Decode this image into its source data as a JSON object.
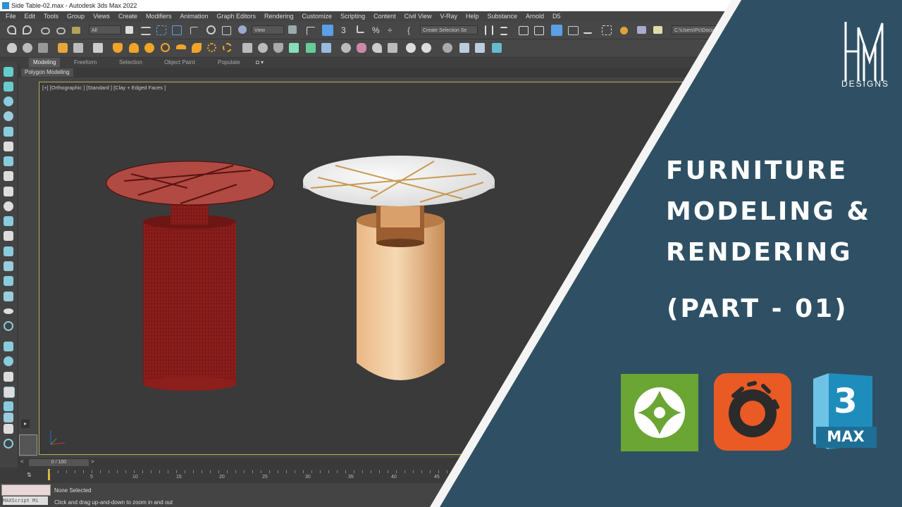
{
  "window": {
    "title": "Side Table-02.max - Autodesk 3ds Max 2022"
  },
  "menu": [
    "File",
    "Edit",
    "Tools",
    "Group",
    "Views",
    "Create",
    "Modifiers",
    "Animation",
    "Graph Editors",
    "Rendering",
    "Customize",
    "Scripting",
    "Content",
    "Civil View",
    "V-Ray",
    "Help",
    "Substance",
    "Arnold",
    "D5"
  ],
  "toolbar": {
    "selection_filter": "All",
    "reference_coord": "View",
    "named_selection": "Create Selection Se",
    "project_path": "C:\\Users\\Pc\\Docume"
  },
  "ribbon": {
    "tabs": [
      "Modeling",
      "Freeform",
      "Selection",
      "Object Paint",
      "Populate"
    ],
    "active_panel": "Polygon Modeling"
  },
  "viewport": {
    "label": "[+] [Orthographic ] [Standard ] [Clay + Edged Faces ]"
  },
  "timeline": {
    "frame_display": "0 / 100",
    "ticks": [
      "5",
      "10",
      "15",
      "20",
      "25",
      "30",
      "35",
      "40",
      "45"
    ]
  },
  "status": {
    "maxscript_label": "MAXScript Mi",
    "selection": "None Selected",
    "prompt": "Click and drag up-and-down to zoom in and out"
  },
  "overlay": {
    "brand": "DESIGNS",
    "title_lines": [
      "FURNITURE",
      "MODELING &",
      "RENDERING"
    ],
    "part": "(PART - 01)",
    "logos": [
      "d5-render-icon",
      "corona-render-icon",
      "3ds-max-icon"
    ],
    "max_number": "3",
    "max_word": "MAX",
    "accent_color": "#2f5064"
  }
}
